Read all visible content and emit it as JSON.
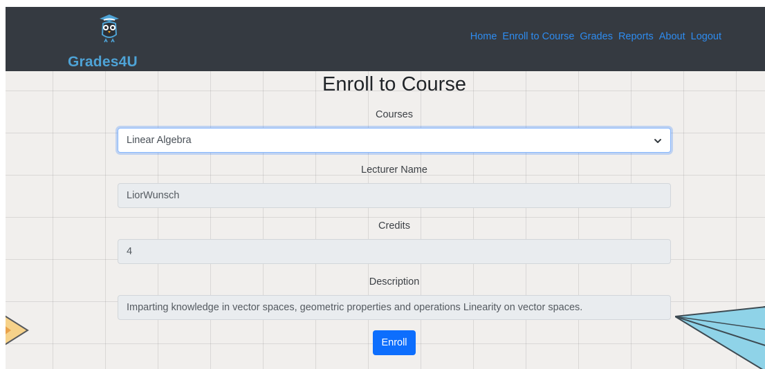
{
  "brand": {
    "name": "Grades4U",
    "color": "#4ea3d6"
  },
  "nav": {
    "links": [
      "Home",
      "Enroll to Course",
      "Grades",
      "Reports",
      "About",
      "Logout"
    ],
    "color": "#2e8cf0"
  },
  "page": {
    "title": "Enroll to Course"
  },
  "form": {
    "courses_label": "Courses",
    "course_selected": "Linear Algebra",
    "lecturer_label": "Lecturer Name",
    "lecturer_value": "LiorWunsch",
    "credits_label": "Credits",
    "credits_value": "4",
    "description_label": "Description",
    "description_value": "Imparting knowledge in vector spaces, geometric properties and operations Linearity on vector spaces.",
    "submit_label": "Enroll"
  },
  "icons": {
    "logo": "owl-graduate-icon",
    "select": "chevron-down-icon"
  },
  "colors": {
    "navbar": "#353a41",
    "primary": "#0d6efd"
  }
}
